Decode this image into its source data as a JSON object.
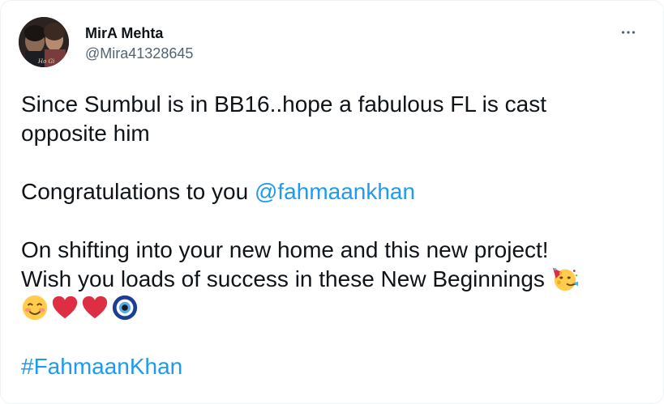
{
  "tweet": {
    "author": {
      "display_name": "MirA Mehta",
      "handle": "@Mira41328645"
    },
    "more_icon": "more-horizontal-icon",
    "body": {
      "line1": "Since Sumbul is in BB16..hope a fabulous FL is cast",
      "line2": "opposite him",
      "congrats_text": "Congratulations to you ",
      "mention": "@fahmaankhan",
      "line4": "On shifting into your new home and this new project!",
      "line5": "Wish you loads of success in these New Beginnings ",
      "hashtag": "#FahmaanKhan"
    },
    "emojis": [
      "partying-face",
      "smiling-face-with-smiling-eyes",
      "red-heart",
      "red-heart",
      "nazar-amulet"
    ]
  },
  "colors": {
    "text": "#0f1419",
    "secondary": "#536471",
    "link": "#1d9bf0",
    "heart": "#dd2e44"
  }
}
